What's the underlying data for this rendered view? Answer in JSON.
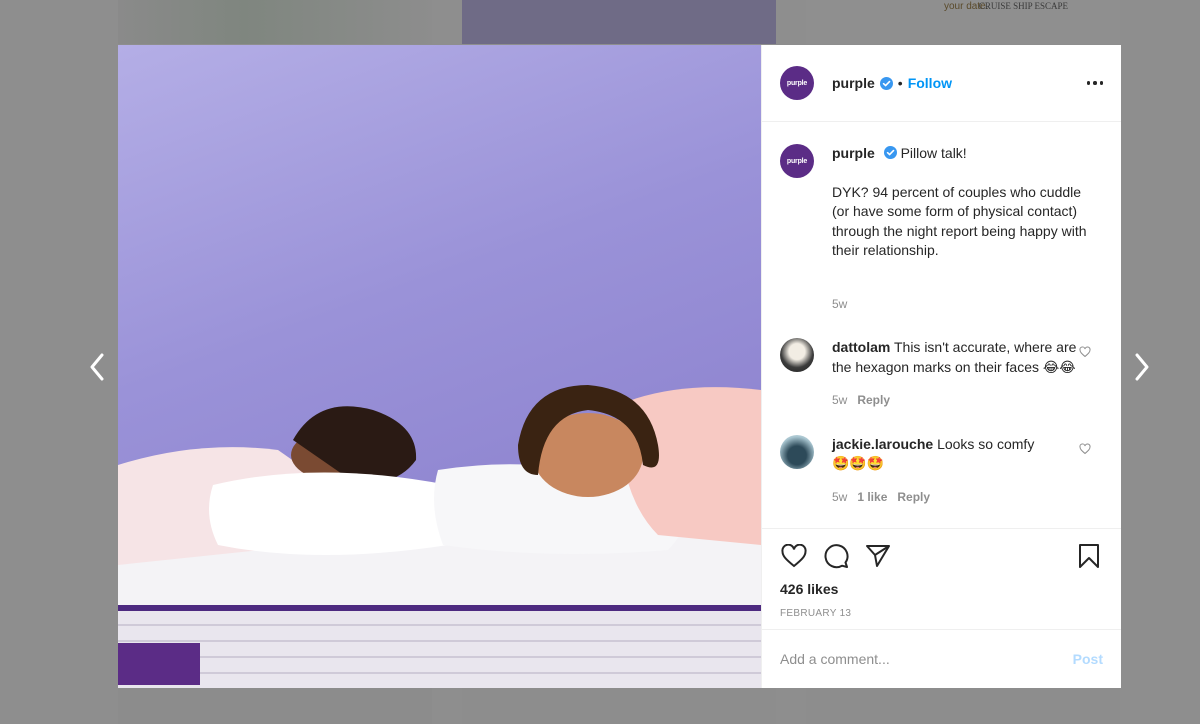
{
  "background": {
    "tile_top_right_text_1": "your date.",
    "tile_top_right_text_2": "CRUISE SHIP ESCAPE"
  },
  "post": {
    "account": {
      "username": "purple",
      "avatar_text": "purple",
      "verified": true,
      "follow_label": "Follow",
      "separator": "•"
    },
    "caption": {
      "username": "purple",
      "headline": "Pillow talk!",
      "body": "DYK? 94 percent of couples who cuddle (or have some form of physical contact) through the night report being happy with their relationship.",
      "time": "5w"
    },
    "comments": [
      {
        "username": "dattolam",
        "text": "This isn't accurate, where are the hexagon marks on their faces",
        "emoji": "😂😂",
        "time": "5w",
        "likes": "",
        "reply_label": "Reply"
      },
      {
        "username": "jackie.larouche",
        "text": "Looks so comfy",
        "emoji": "🤩🤩🤩",
        "time": "5w",
        "likes": "1 like",
        "reply_label": "Reply"
      }
    ],
    "likes": "426 likes",
    "date": "FEBRUARY 13",
    "add_comment": {
      "placeholder": "Add a comment...",
      "post_label": "Post"
    }
  },
  "colors": {
    "brand_purple": "#5b2c86",
    "link_blue": "#0095f6",
    "post_disabled": "#b3dbff"
  }
}
